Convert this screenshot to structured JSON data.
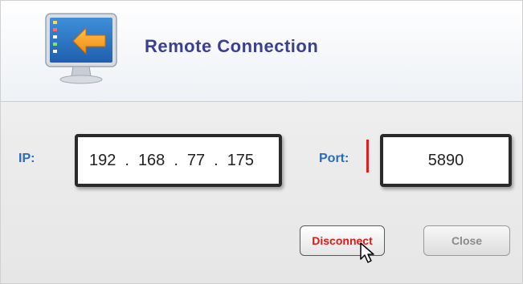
{
  "header": {
    "title": "Remote Connection",
    "icon": "monitor-arrow-icon"
  },
  "form": {
    "ip_label": "IP:",
    "ip_octets": [
      "192",
      "168",
      "77",
      "175"
    ],
    "ip_separator": ".",
    "port_label": "Port:",
    "port_value": "5890"
  },
  "actions": {
    "disconnect_label": "Disconnect",
    "close_label": "Close"
  },
  "colors": {
    "title": "#3b3f8f",
    "label": "#2b6cb8",
    "disconnect_text": "#e01818",
    "close_text": "#8a8a8a",
    "caret": "#e02020"
  }
}
